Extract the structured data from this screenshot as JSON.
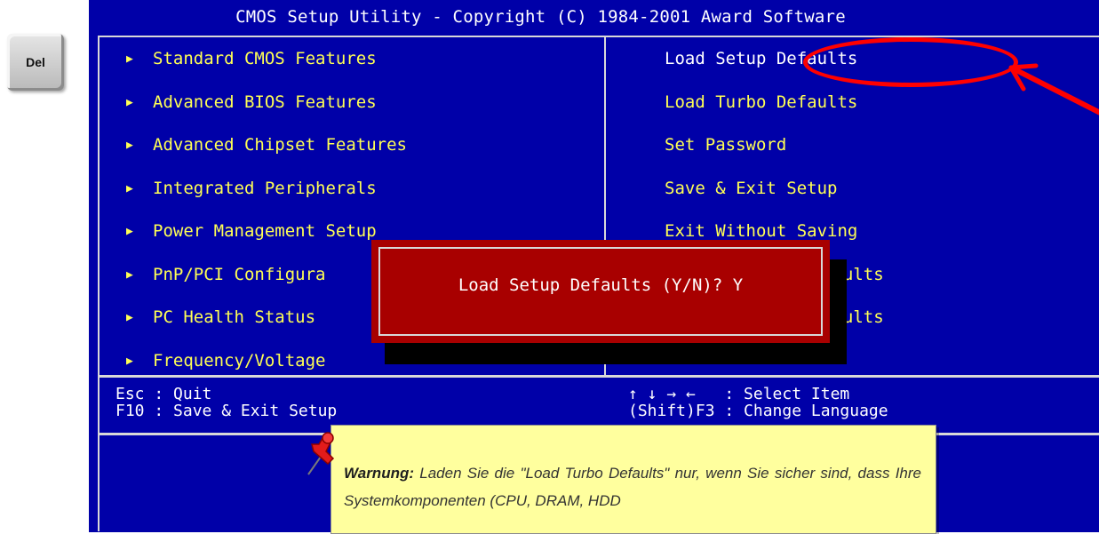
{
  "del_key": "Del",
  "title": "CMOS Setup Utility - Copyright (C) 1984-2001 Award Software",
  "left_menu": [
    "Standard CMOS Features",
    "Advanced BIOS Features",
    "Advanced Chipset Features",
    "Integrated Peripherals",
    "Power Management Setup",
    "PnP/PCI Configura",
    "PC Health Status",
    "Frequency/Voltage"
  ],
  "right_menu": [
    "Load Setup Defaults",
    "Load Turbo Defaults",
    "Set Password",
    "Save & Exit Setup",
    "Exit Without Saving",
    "faults",
    "faults"
  ],
  "help": {
    "left_line1": "Esc : Quit",
    "left_line2": "F10 : Save & Exit Setup",
    "right_line1": "↑ ↓ → ←   : Select Item",
    "right_line2": "(Shift)F3 : Change Language"
  },
  "dialog": {
    "prompt": "Load Setup Defaults (Y/N)? Y"
  },
  "note": {
    "label": "Warnung:",
    "text": " Laden Sie die \"Load Turbo Defaults\" nur, wenn Sie sicher sind, dass Ihre Systemkomponenten (CPU, DRAM, HDD"
  },
  "colors": {
    "bios_background": "#0000a8",
    "menu_text": "#ffff54",
    "dialog_background": "#a80000",
    "annotation": "#ff0000",
    "note_background": "#ffff9e"
  },
  "icons": {
    "left_menu_arrow": "triangle-right-icon",
    "note_pin": "pushpin-icon",
    "annotation": "red-arrow-icon"
  }
}
